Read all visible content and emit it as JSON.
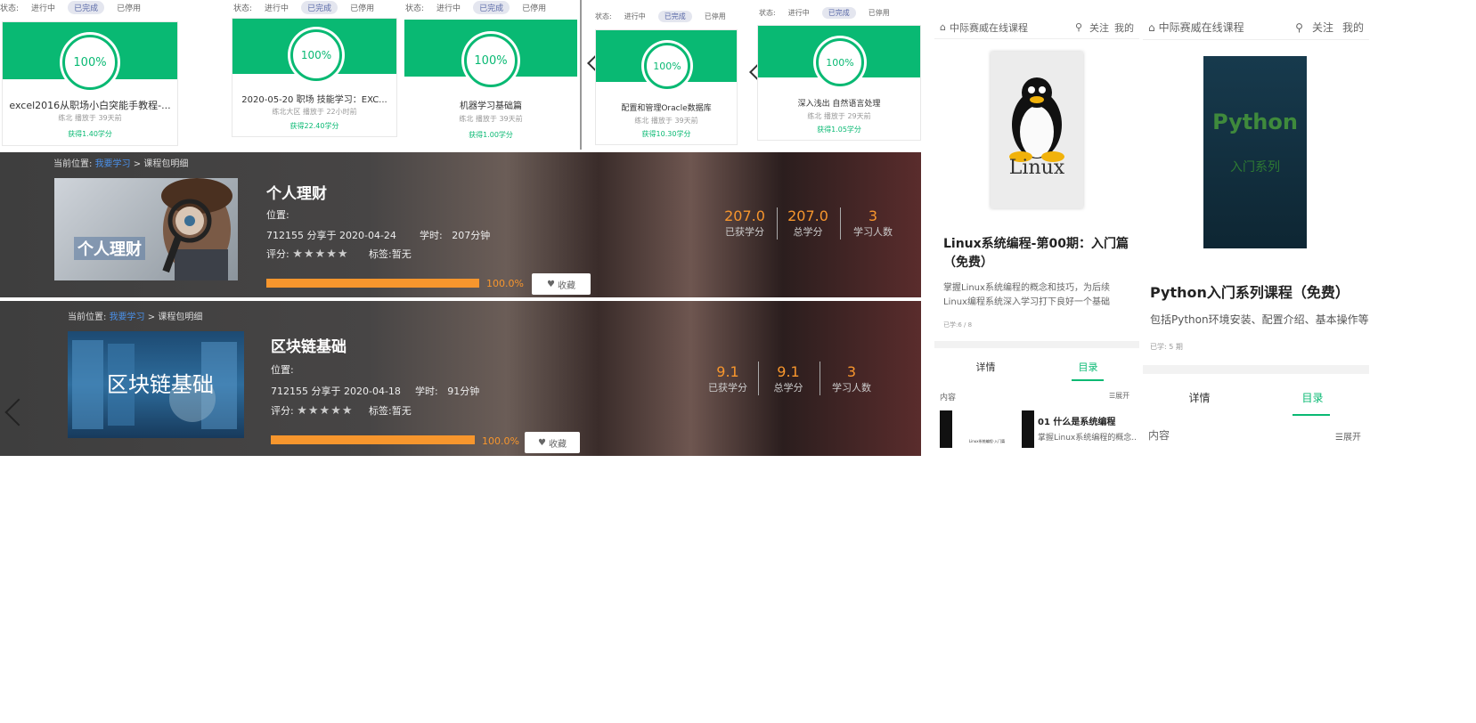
{
  "filters": {
    "label": "状态:",
    "options": [
      "进行中",
      "已完成",
      "已停用"
    ]
  },
  "cards": [
    {
      "pct": "100%",
      "title": "excel2016从职场小白突能手教程-...",
      "meta": "练北  播放于 39天前",
      "score": "获得1.40学分"
    },
    {
      "pct": "100%",
      "title": "2020-05-20 职场 技能学习：EXC...",
      "meta": "练北大区  播放于 22小时前",
      "score": "获得22.40学分"
    },
    {
      "pct": "100%",
      "title": "机器学习基础篇",
      "meta": "练北  播放于 39天前",
      "score": "获得1.00学分"
    },
    {
      "pct": "100%",
      "title": "配置和管理Oracle数据库",
      "meta": "练北  播放于 39天前",
      "score": "获得10.30学分"
    },
    {
      "pct": "100%",
      "title": "深入浅出 自然语言处理",
      "meta": "练北  播放于 29天前",
      "score": "获得1.05学分"
    }
  ],
  "breadcrumb": {
    "prefix": "当前位置:",
    "link": "我要学习",
    "sep": ">",
    "current": "课程包明细"
  },
  "banners": [
    {
      "thumb": "个人理财",
      "title": "个人理财",
      "position_label": "位置:",
      "shared": "712155 分享于 2020-04-24",
      "hours_label": "学时:",
      "hours": "207分钟",
      "rating_label": "评分:",
      "tag_label": "标签:",
      "tag": "暂无",
      "progress": 1.0,
      "progress_text": "100.0%",
      "fav": "收藏",
      "earned": "207.0",
      "earned_label": "已获学分",
      "total": "207.0",
      "total_label": "总学分",
      "learners": "3",
      "learners_label": "学习人数"
    },
    {
      "thumb": "区块链基础",
      "title": "区块链基础",
      "position_label": "位置:",
      "shared": "712155 分享于 2020-04-18",
      "hours_label": "学时:",
      "hours": "91分钟",
      "rating_label": "评分:",
      "tag_label": "标签:",
      "tag": "暂无",
      "progress": 1.0,
      "progress_text": "100.0%",
      "fav": "收藏",
      "earned": "9.1",
      "earned_label": "已获学分",
      "total": "9.1",
      "total_label": "总学分",
      "learners": "3",
      "learners_label": "学习人数"
    }
  ],
  "mobile": [
    {
      "site": "中际赛威在线课程",
      "follow": "关注",
      "mine": "我的",
      "cover_text": "Linux",
      "title": "Linux系统编程-第00期：入门篇（免费）",
      "desc": "掌握Linux系统编程的概念和技巧，为后续Linux编程系统深入学习打下良好一个基础",
      "meta": "已学:6 / 8",
      "tab1": "详情",
      "tab2": "目录",
      "content": "内容",
      "expand": "展开",
      "item_title": "01 什么是系统编程",
      "item_desc": "掌握Linux系统编程的概念...",
      "item_thumb": "Linux系统编程-入门篇"
    },
    {
      "site": "中际赛威在线课程",
      "follow": "关注",
      "mine": "我的",
      "cover_title": "Python",
      "cover_sub": "入门系列",
      "title": "Python入门系列课程（免费）",
      "desc": "包括Python环境安装、配置介绍、基本操作等",
      "meta": "已学: 5 期",
      "tab1": "详情",
      "tab2": "目录",
      "content": "内容",
      "expand": "展开"
    }
  ]
}
